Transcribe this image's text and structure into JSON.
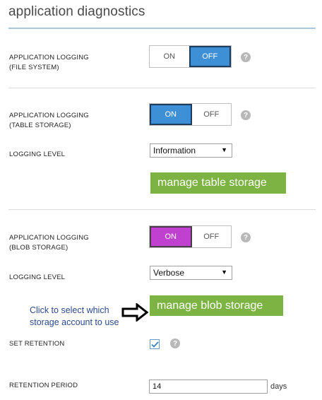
{
  "header": {
    "title": "application diagnostics"
  },
  "file_system": {
    "label_line1": "APPLICATION LOGGING",
    "label_line2": "(FILE SYSTEM)",
    "on_label": "ON",
    "off_label": "OFF",
    "selected": "OFF",
    "help_icon": "?"
  },
  "table_storage": {
    "label_line1": "APPLICATION LOGGING",
    "label_line2": "(TABLE STORAGE)",
    "on_label": "ON",
    "off_label": "OFF",
    "selected": "ON",
    "help_icon": "?",
    "level_label": "LOGGING LEVEL",
    "level_value": "Information",
    "manage_button": "manage table storage"
  },
  "blob_storage": {
    "label_line1": "APPLICATION LOGGING",
    "label_line2": "(BLOB STORAGE)",
    "on_label": "ON",
    "off_label": "OFF",
    "selected": "ON",
    "help_icon": "?",
    "level_label": "LOGGING LEVEL",
    "level_value": "Verbose",
    "manage_button": "manage blob storage",
    "annotation_line1": "Click to select which",
    "annotation_line2": "storage account to use"
  },
  "retention": {
    "set_label": "SET RETENTION",
    "checked": true,
    "help_icon": "?",
    "period_label": "RETENTION PERIOD",
    "period_value": "14",
    "period_units": "days"
  },
  "colors": {
    "toggle_on_blue": "#3d8fd6",
    "toggle_on_purple": "#c040d0",
    "manage_button_green": "#7cb342",
    "annotation_text": "#2b4a8a"
  }
}
